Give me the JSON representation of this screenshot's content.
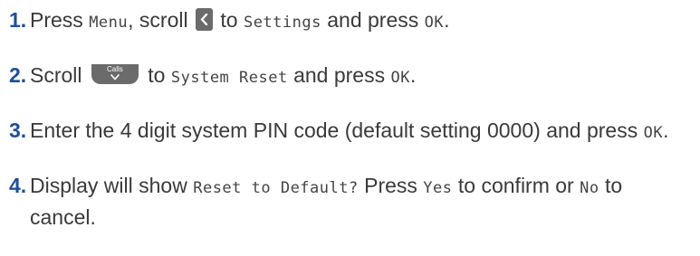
{
  "steps": [
    {
      "number": "1.",
      "parts": {
        "t1": "Press ",
        "c1": "Menu",
        "t2": ", scroll ",
        "t3": " to ",
        "c2": "Settings",
        "t4": " and press ",
        "c3": "OK",
        "t5": "."
      },
      "icon": "scroll-left-key-icon"
    },
    {
      "number": "2.",
      "parts": {
        "t1": "Scroll ",
        "t2": " to ",
        "c1": "System Reset",
        "t3": " and press ",
        "c2": "OK",
        "t4": "."
      },
      "icon": "calls-down-key-icon",
      "key_label": "Calls"
    },
    {
      "number": "3.",
      "parts": {
        "t1": "Enter the 4 digit system PIN code (default setting 0000) and press ",
        "c1": "OK",
        "t2": "."
      }
    },
    {
      "number": "4.",
      "parts": {
        "t1": "Display will show ",
        "c1": "Reset to Default?",
        "t2": " Press ",
        "c2": "Yes",
        "t3": " to confirm or ",
        "c3": "No",
        "t4": " to cancel."
      }
    }
  ],
  "colors": {
    "number": "#1f4e9c",
    "text": "#3a3a3a",
    "key": "#6b6b6b"
  }
}
